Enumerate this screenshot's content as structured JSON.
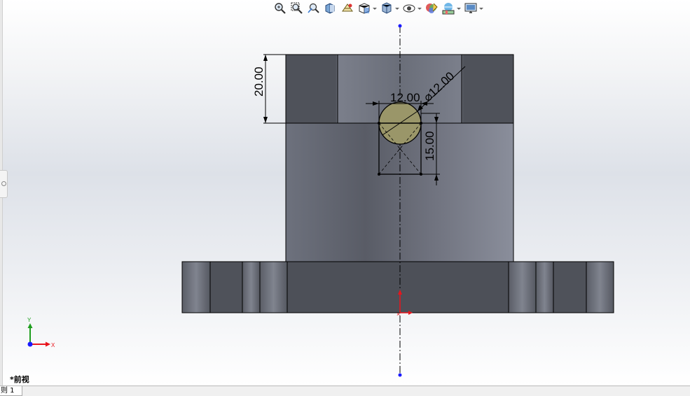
{
  "toolbar": {
    "items": [
      {
        "icon": "zoom-to-fit-icon",
        "dropdown": false
      },
      {
        "icon": "zoom-to-area-icon",
        "dropdown": false
      },
      {
        "icon": "previous-view-icon",
        "dropdown": false
      },
      {
        "icon": "section-view-icon",
        "dropdown": false
      },
      {
        "icon": "dynamic-annotation-icon",
        "dropdown": false
      },
      {
        "icon": "view-orientation-icon",
        "dropdown": true
      },
      {
        "icon": "display-style-icon",
        "dropdown": true
      },
      {
        "icon": "hide-show-items-icon",
        "dropdown": true
      },
      {
        "icon": "edit-appearance-icon",
        "dropdown": false
      },
      {
        "icon": "apply-scene-icon",
        "dropdown": true
      },
      {
        "icon": "view-settings-icon",
        "dropdown": true
      }
    ]
  },
  "dimensions": {
    "height_top": "20.00",
    "width_sketch": "12.00",
    "diameter": "⌀12.00",
    "height_sketch": "15.00"
  },
  "triad": {
    "x_label": "X",
    "y_label": "Y"
  },
  "view_label": "*前视",
  "sheet_tab": "则 1",
  "colors": {
    "part_dark": "#53565f",
    "part_light": "#878b98",
    "sketch_fill": "#9a9669",
    "axis_blue": "#1a1aff",
    "origin_red": "#e8141c",
    "triad_green": "#1e9e1e"
  }
}
